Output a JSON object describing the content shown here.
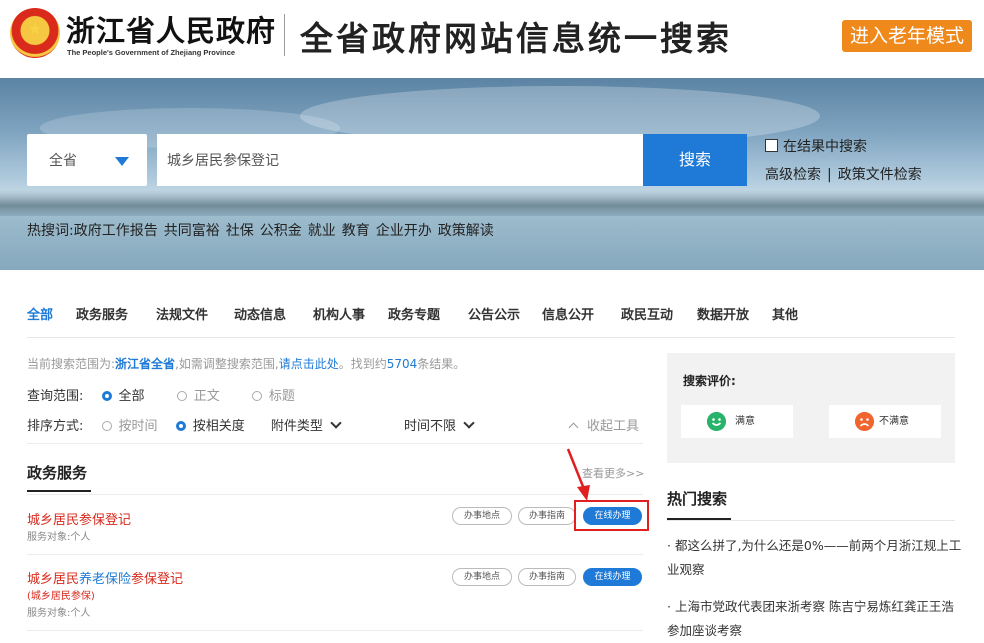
{
  "header": {
    "site_name": "浙江省人民政府",
    "site_name_en": "The People's Government of Zhejiang Province",
    "search_title": "全省政府网站信息统一搜索",
    "elder_mode": "进入老年模式"
  },
  "search": {
    "scope": "全省",
    "query": "城乡居民参保登记",
    "button": "搜索",
    "in_result": "在结果中搜索",
    "advanced": "高级检索",
    "sep": "|",
    "policy": "政策文件检索"
  },
  "hotwords": {
    "label": "热搜词:",
    "items": [
      "政府工作报告",
      "共同富裕",
      "社保",
      "公积金",
      "就业",
      "教育",
      "企业开办",
      "政策解读"
    ]
  },
  "tabs": [
    "全部",
    "政务服务",
    "法规文件",
    "动态信息",
    "机构人事",
    "政务专题",
    "公告公示",
    "信息公开",
    "政民互动",
    "数据开放",
    "其他"
  ],
  "scope_info": {
    "prefix": "当前搜索范围为:",
    "scope": "浙江省全省",
    "mid": ",如需调整搜索范围,",
    "link": "请点击此处",
    "found": "。找到约",
    "count": "5704",
    "suffix": "条结果。"
  },
  "filters": {
    "range_label": "查询范围:",
    "range_options": [
      "全部",
      "正文",
      "标题"
    ],
    "sort_label": "排序方式:",
    "sort_options": [
      "按时间",
      "按相关度"
    ],
    "attach_type": "附件类型",
    "time_limit": "时间不限",
    "collapse": "收起工具"
  },
  "section": {
    "title": "政务服务",
    "more": "查看更多>>"
  },
  "results": [
    {
      "title_part1": "城乡居民参保登记",
      "title_part2": "",
      "title_part3": "",
      "sub_red": "",
      "sub": "服务对象:个人",
      "btn_location": "办事地点",
      "btn_guide": "办事指南",
      "btn_online": "在线办理"
    },
    {
      "title_part1": "城乡居民",
      "title_part2": "养老保险",
      "title_part3": "参保登记",
      "sub_red": "(城乡居民参保)",
      "sub": "服务对象:个人",
      "btn_location": "办事地点",
      "btn_guide": "办事指南",
      "btn_online": "在线办理"
    }
  ],
  "evaluation": {
    "title": "搜索评价:",
    "good": "满意",
    "bad": "不满意"
  },
  "hot_search": {
    "title": "热门搜索",
    "items": [
      "都这么拼了,为什么还是0%——前两个月浙江规上工业观察",
      "上海市党政代表团来浙考察 陈吉宁易炼红龚正王浩参加座谈考察"
    ]
  },
  "colors": {
    "accent": "#1e7ad6",
    "orange": "#f0891c",
    "highlight_red": "#d9291c",
    "annotation_red": "#e02020"
  }
}
